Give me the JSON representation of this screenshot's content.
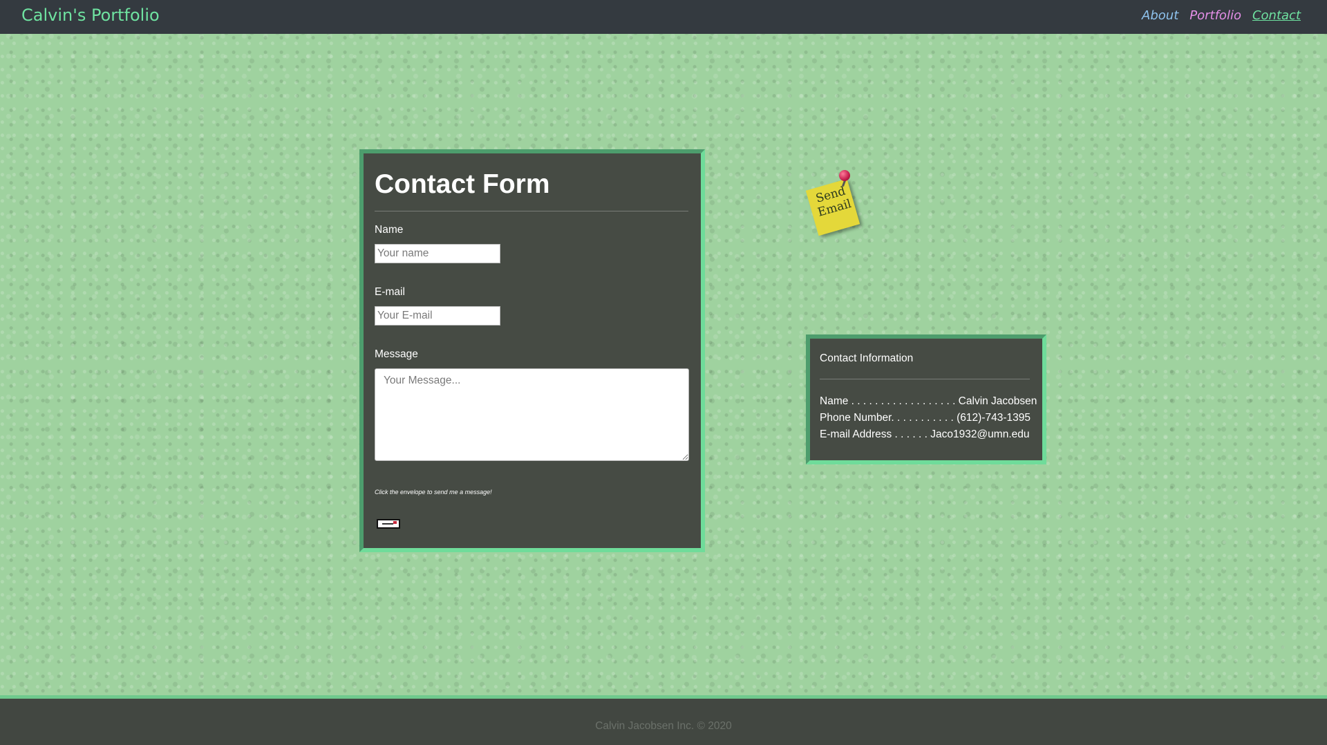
{
  "navbar": {
    "brand": "Calvin's Portfolio",
    "links": [
      {
        "label": "About"
      },
      {
        "label": "Portfolio"
      },
      {
        "label": "Contact"
      }
    ]
  },
  "contact_form": {
    "title": "Contact Form",
    "name_label": "Name",
    "name_placeholder": "Your name",
    "email_label": "E-mail",
    "email_placeholder": "Your E-mail",
    "message_label": "Message",
    "message_placeholder": "Your Message...",
    "hint": "Click the envelope to send me a message!",
    "send_icon": "envelope-icon"
  },
  "sticky_note": {
    "text": "Send Email",
    "icon": "pushpin-icon"
  },
  "contact_info": {
    "title": "Contact Information",
    "rows": [
      {
        "text": "Name . . . . . . . . . . . . . . . . . . Calvin Jacobsen"
      },
      {
        "text": "Phone Number. . . . . . . . . . . (612)-743-1395"
      },
      {
        "text": "E-mail Address . . . . . . Jaco1932@umn.edu"
      }
    ]
  },
  "footer": {
    "text": "Calvin Jacobsen Inc. © 2020"
  },
  "colors": {
    "accent": "#6fe3a1",
    "navbar": "#343a40",
    "card": "#464b44",
    "background": "#9fd29f"
  }
}
